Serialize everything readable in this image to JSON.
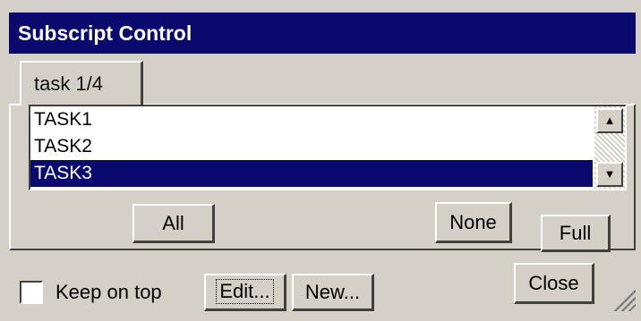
{
  "window": {
    "title": "Subscript Control"
  },
  "tabs": [
    {
      "label": "task 1/4"
    }
  ],
  "list": {
    "items": [
      {
        "label": "TASK1",
        "selected": false
      },
      {
        "label": "TASK2",
        "selected": false
      },
      {
        "label": "TASK3",
        "selected": true
      }
    ],
    "scroll_up_icon": "arrow-up-icon",
    "scroll_down_icon": "arrow-down-icon"
  },
  "buttons": {
    "all": "All",
    "none": "None",
    "full": "Full",
    "edit": "Edit...",
    "new": "New...",
    "close": "Close"
  },
  "options": {
    "keep_on_top_label": "Keep on top",
    "keep_on_top_checked": false
  },
  "colors": {
    "titlebar": "#0a0a6e",
    "selection": "#0a0a6e",
    "face": "#d4d0c8"
  }
}
